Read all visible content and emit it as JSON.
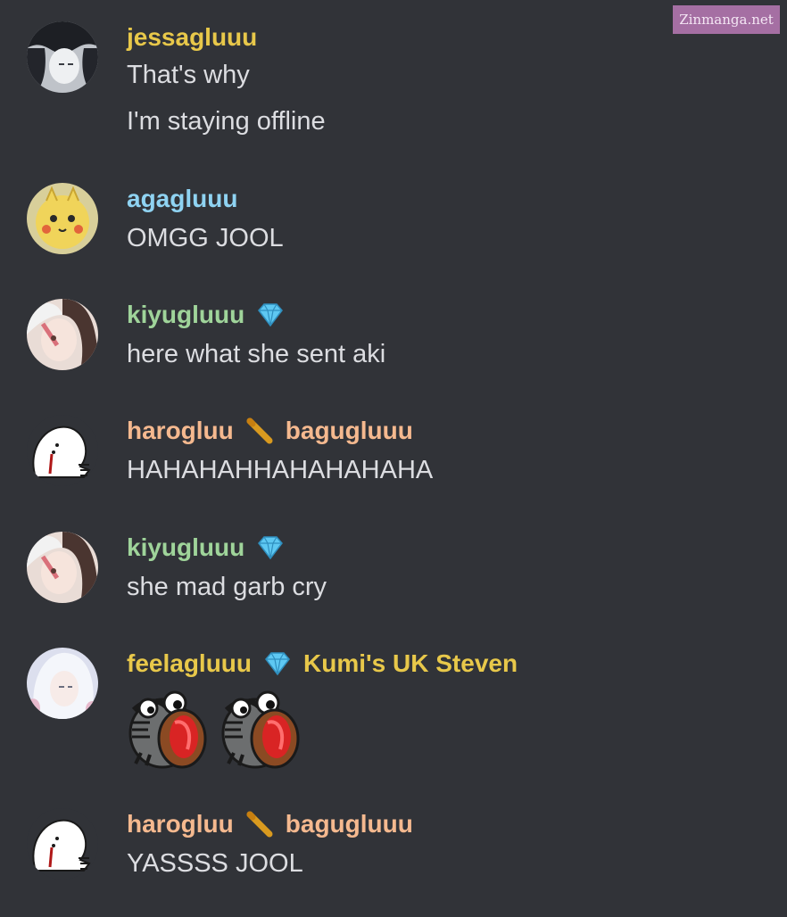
{
  "watermark": "Zinmanga.net",
  "colors": {
    "background": "#313338",
    "text": "#dcdde1",
    "jessagluuu": "#e8c84a",
    "agagluuu": "#8fd3f2",
    "kiyugluuu": "#9fd49a",
    "harogluu": "#f5b98f",
    "bagugluuu": "#f5b98f",
    "feelagluuu": "#e8c84a",
    "kumi": "#e8c84a"
  },
  "messages": [
    {
      "author": "jessagluuu",
      "icon": "",
      "lines": [
        "That's why",
        "I'm staying offline"
      ]
    },
    {
      "author": "agagluuu",
      "icon": "",
      "lines": [
        "OMGG JOOL"
      ]
    },
    {
      "author": "kiyugluuu",
      "icon": "diamond-icon",
      "lines": [
        "here what she sent aki"
      ]
    },
    {
      "author": "harogluu",
      "icon": "pencil-icon",
      "extra_name": "bagugluuu",
      "lines": [
        "HAHAHAHHAHAHAHAHA"
      ]
    },
    {
      "author": "kiyugluuu",
      "icon": "diamond-icon",
      "lines": [
        "she mad garb cry"
      ]
    },
    {
      "author": "feelagluuu",
      "icon": "diamond-icon",
      "extra_name": "Kumi's UK Steven",
      "emotes": [
        "crying-emote",
        "crying-emote"
      ]
    },
    {
      "author": "harogluu",
      "icon": "pencil-icon",
      "extra_name": "bagugluuu",
      "lines": [
        "YASSSS JOOL"
      ]
    }
  ]
}
